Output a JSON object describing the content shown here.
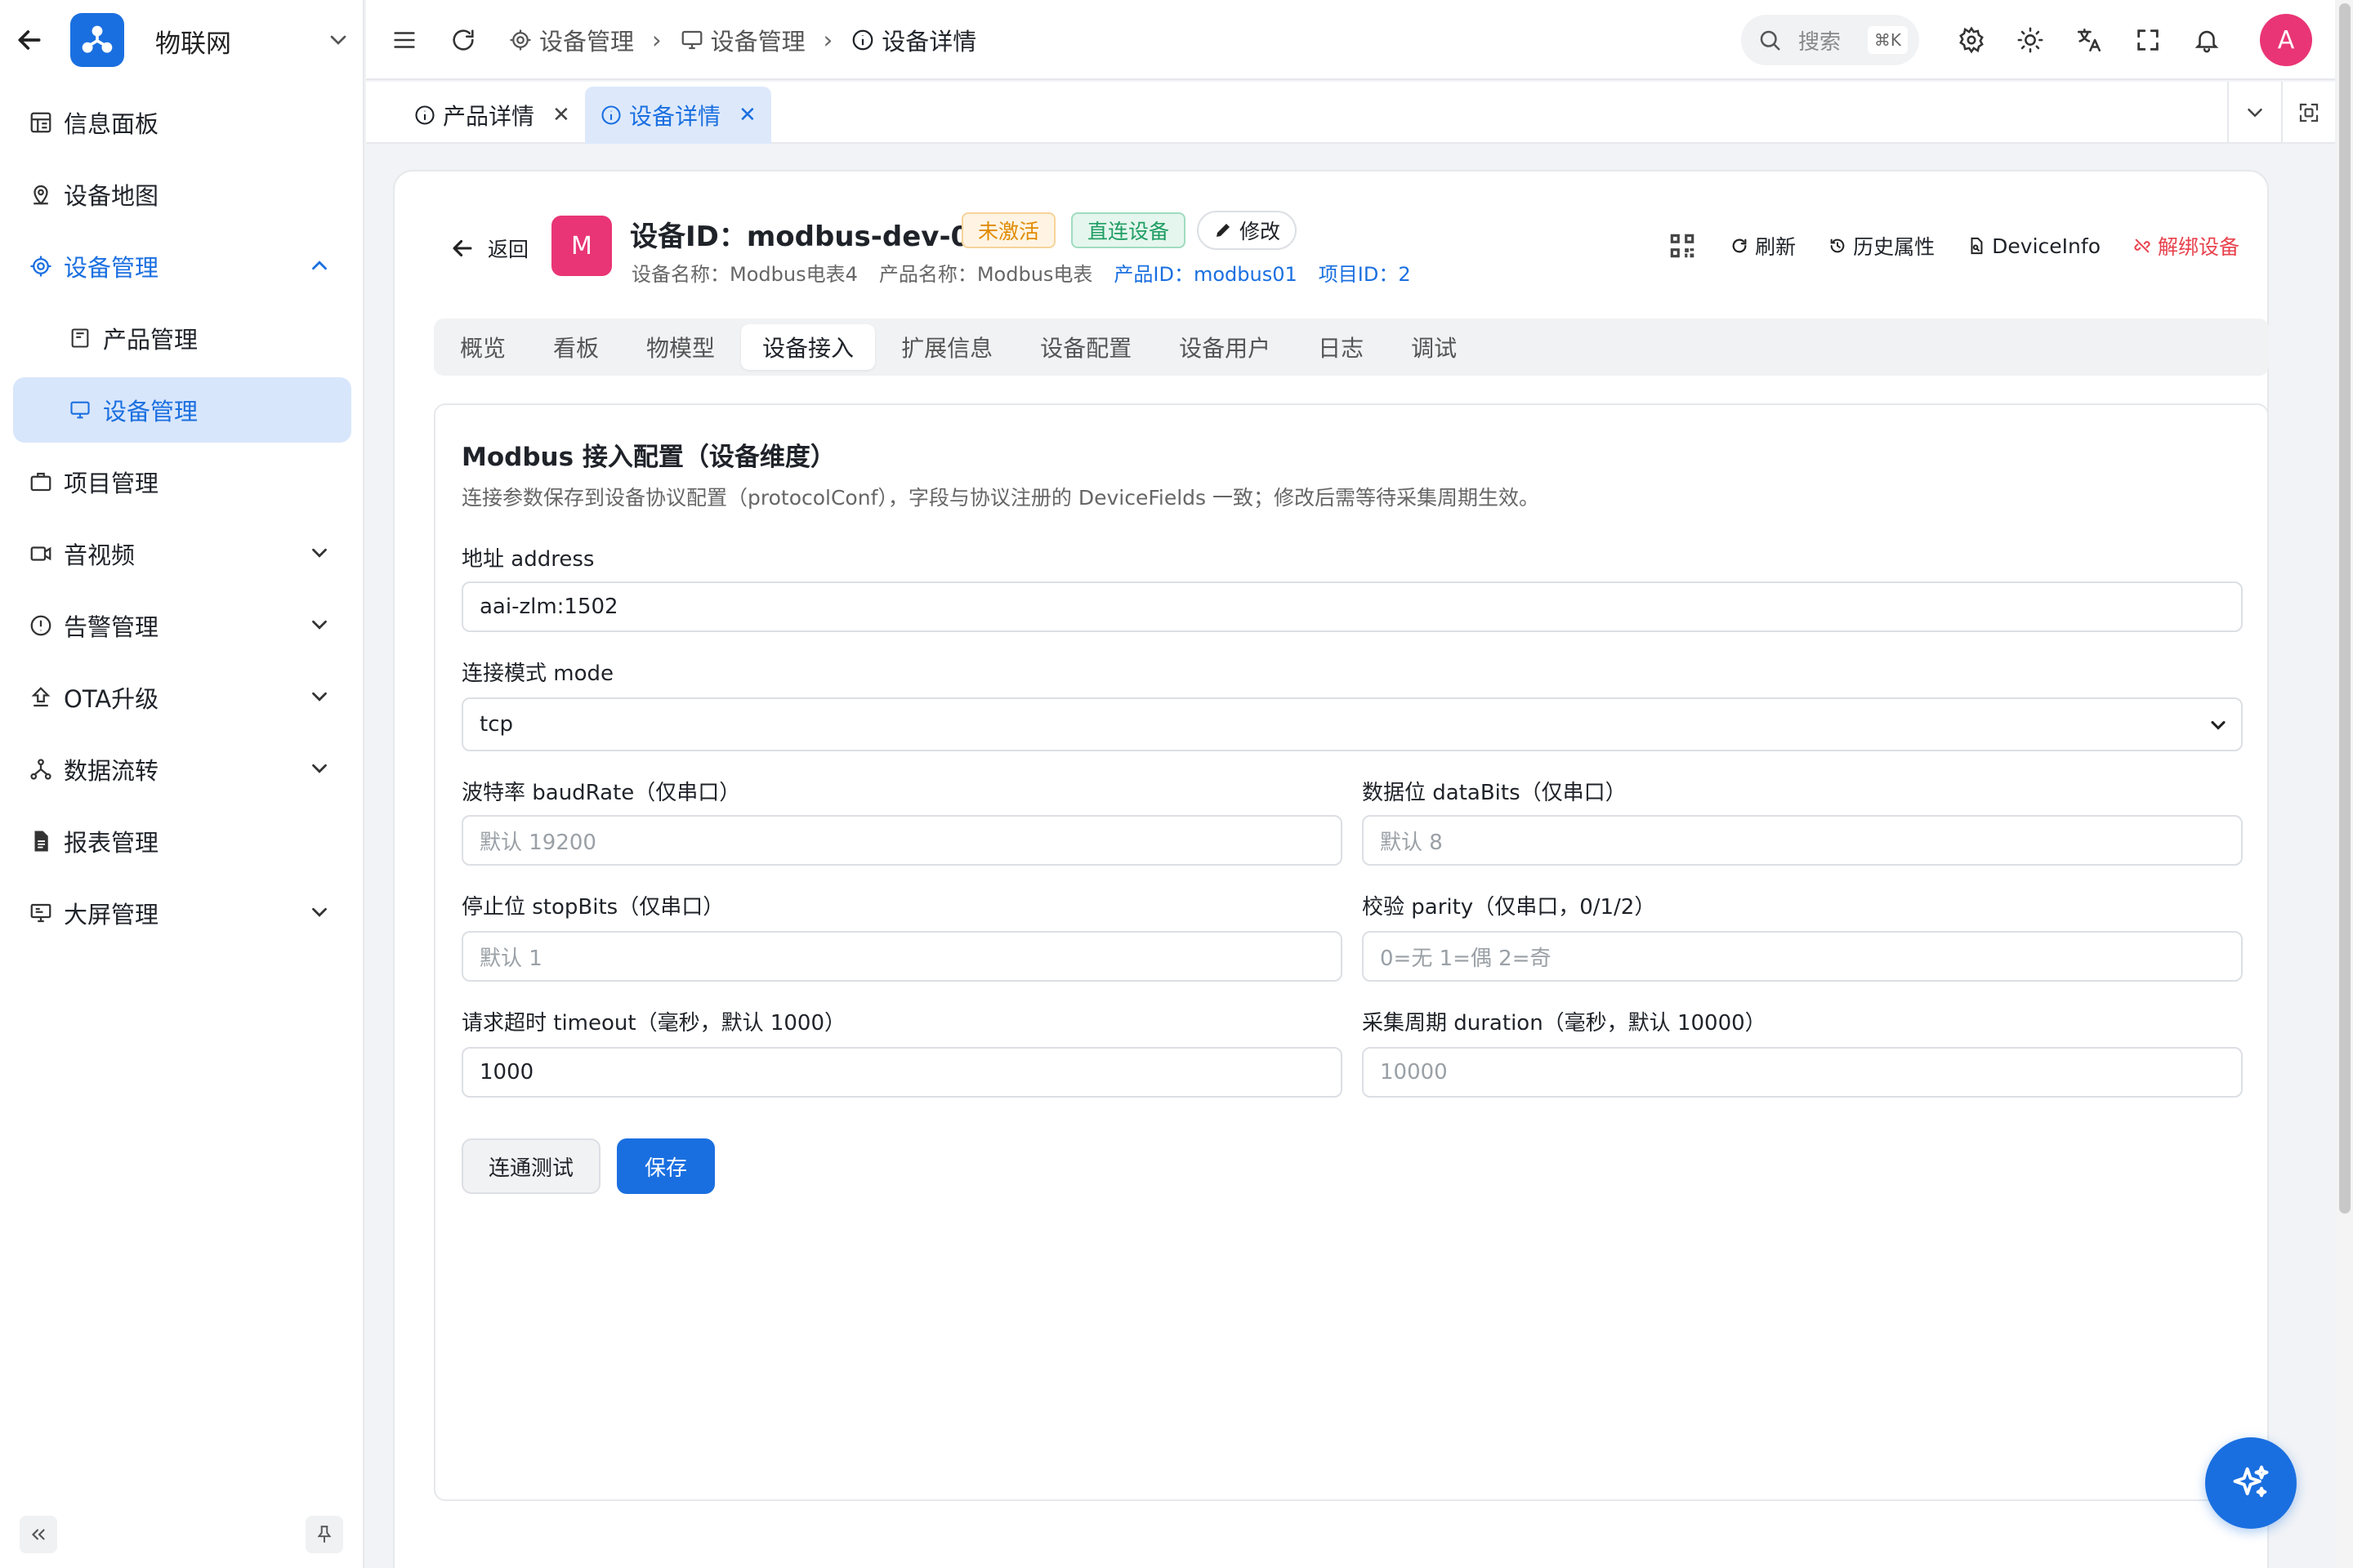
{
  "app": {
    "title": "物联网"
  },
  "sidebar": {
    "items": [
      {
        "label": "信息面板",
        "icon": "dashboard-icon"
      },
      {
        "label": "设备地图",
        "icon": "map-pin-icon"
      },
      {
        "label": "设备管理",
        "icon": "device-chip-icon",
        "expanded": true
      },
      {
        "label": "产品管理",
        "icon": "product-icon"
      },
      {
        "label": "设备管理",
        "icon": "device-icon",
        "selected": true
      },
      {
        "label": "项目管理",
        "icon": "briefcase-icon"
      },
      {
        "label": "音视频",
        "icon": "video-icon"
      },
      {
        "label": "告警管理",
        "icon": "alert-icon"
      },
      {
        "label": "OTA升级",
        "icon": "upload-icon"
      },
      {
        "label": "数据流转",
        "icon": "flow-icon"
      },
      {
        "label": "报表管理",
        "icon": "report-icon"
      },
      {
        "label": "大屏管理",
        "icon": "screen-icon"
      }
    ]
  },
  "topbar": {
    "breadcrumbs": [
      "设备管理",
      "设备管理",
      "设备详情"
    ],
    "search_label": "搜索",
    "search_shortcut": "⌘K",
    "avatar_letter": "A"
  },
  "page_tabs": [
    {
      "label": "产品详情",
      "active": false
    },
    {
      "label": "设备详情",
      "active": true
    }
  ],
  "device": {
    "back_label": "返回",
    "avatar_letter": "M",
    "title": "设备ID：modbus-dev-001",
    "status_tag": "未激活",
    "type_tag": "直连设备",
    "edit_label": "修改",
    "device_name": "设备名称：Modbus电表4",
    "product_name": "产品名称：Modbus电表",
    "product_id": "产品ID：modbus01",
    "project_id": "项目ID：2",
    "actions": {
      "refresh": "刷新",
      "history": "历史属性",
      "device_info": "DeviceInfo",
      "unbind": "解绑设备"
    }
  },
  "sub_tabs": [
    "概览",
    "看板",
    "物模型",
    "设备接入",
    "扩展信息",
    "设备配置",
    "设备用户",
    "日志",
    "调试"
  ],
  "sub_tab_active": "设备接入",
  "form": {
    "title": "Modbus 接入配置（设备维度）",
    "description": "连接参数保存到设备协议配置（protocolConf），字段与协议注册的 DeviceFields 一致；修改后需等待采集周期生效。",
    "address": {
      "label": "地址 address",
      "value": "aai-zlm:1502"
    },
    "mode": {
      "label": "连接模式 mode",
      "value": "tcp"
    },
    "baud_rate": {
      "label": "波特率 baudRate（仅串口）",
      "placeholder": "默认 19200"
    },
    "data_bits": {
      "label": "数据位 dataBits（仅串口）",
      "placeholder": "默认 8"
    },
    "stop_bits": {
      "label": "停止位 stopBits（仅串口）",
      "placeholder": "默认 1"
    },
    "parity": {
      "label": "校验 parity（仅串口，0/1/2）",
      "placeholder": "0=无 1=偶 2=奇"
    },
    "timeout": {
      "label": "请求超时 timeout（毫秒，默认 1000）",
      "value": "1000"
    },
    "duration": {
      "label": "采集周期 duration（毫秒，默认 10000）",
      "placeholder": "10000"
    },
    "test_button": "连通测试",
    "save_button": "保存"
  },
  "colors": {
    "primary": "#1a6fe0",
    "avatar": "#e93575",
    "danger": "#e8424d",
    "warning": "#e08a00",
    "success": "#1f9d63"
  }
}
